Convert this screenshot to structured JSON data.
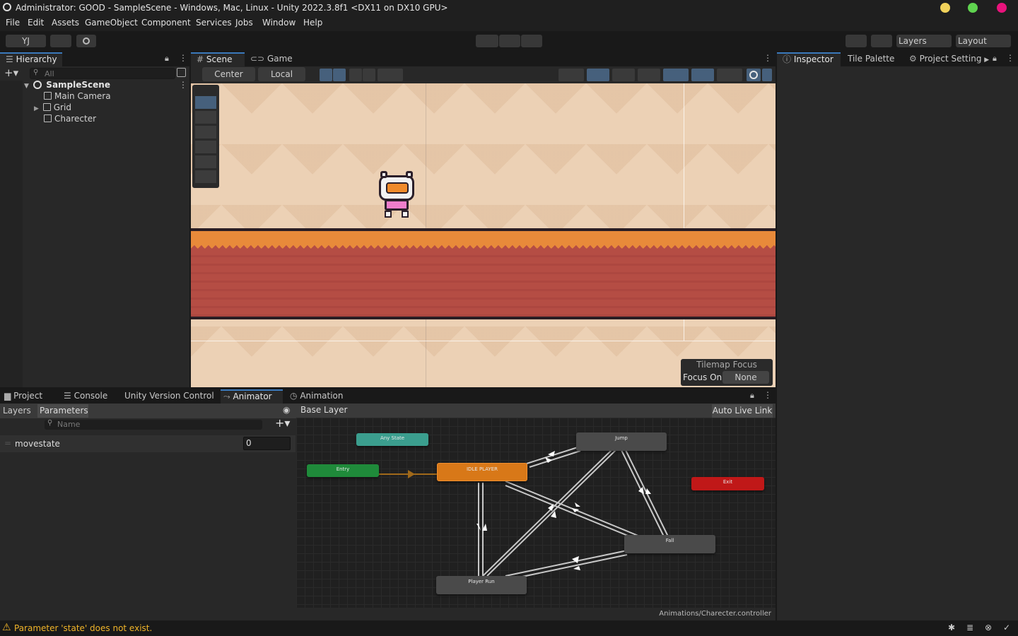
{
  "window": {
    "title": "Administrator: GOOD - SampleScene - Windows, Mac, Linux - Unity 2022.3.8f1 <DX11 on DX10 GPU>",
    "buttons": {
      "minimize_color": "#f1d25b",
      "maximize_color": "#5fd34f",
      "close_color": "#e9137c"
    }
  },
  "menu": [
    "File",
    "Edit",
    "Assets",
    "GameObject",
    "Component",
    "Services",
    "Jobs",
    "Window",
    "Help"
  ],
  "toolbar": {
    "account": "YJ",
    "layers": "Layers",
    "layout": "Layout"
  },
  "hierarchy": {
    "tab": "Hierarchy",
    "search_placeholder": "All",
    "scene": "SampleScene",
    "items": [
      "Main Camera",
      "Grid",
      "Charecter"
    ]
  },
  "scene": {
    "tabs": [
      "Scene",
      "Game"
    ],
    "pivot": "Center",
    "space": "Local",
    "tilemap_focus": {
      "title": "Tilemap Focus",
      "label": "Focus On",
      "value": "None"
    }
  },
  "inspector": {
    "tabs": [
      "Inspector",
      "Tile Palette",
      "Project Setting"
    ]
  },
  "bottom": {
    "tabs": [
      "Project",
      "Console",
      "Unity Version Control",
      "Animator",
      "Animation"
    ],
    "sub_tabs": [
      "Layers",
      "Parameters"
    ],
    "breadcrumb": "Base Layer",
    "auto_live_link": "Auto Live Link",
    "search_placeholder": "Name",
    "parameter": {
      "name": "movestate",
      "value": "0"
    },
    "states": {
      "any": "Any State",
      "entry": "Entry",
      "idle": "IDLE PLAYER",
      "jump": "Jump",
      "exit": "Exit",
      "fall": "Fall",
      "run": "Player Run"
    },
    "controller_path": "Animations/Charecter.controller"
  },
  "status": {
    "message": "Parameter 'state' does not exist.",
    "warning_color": "#f0b429"
  }
}
